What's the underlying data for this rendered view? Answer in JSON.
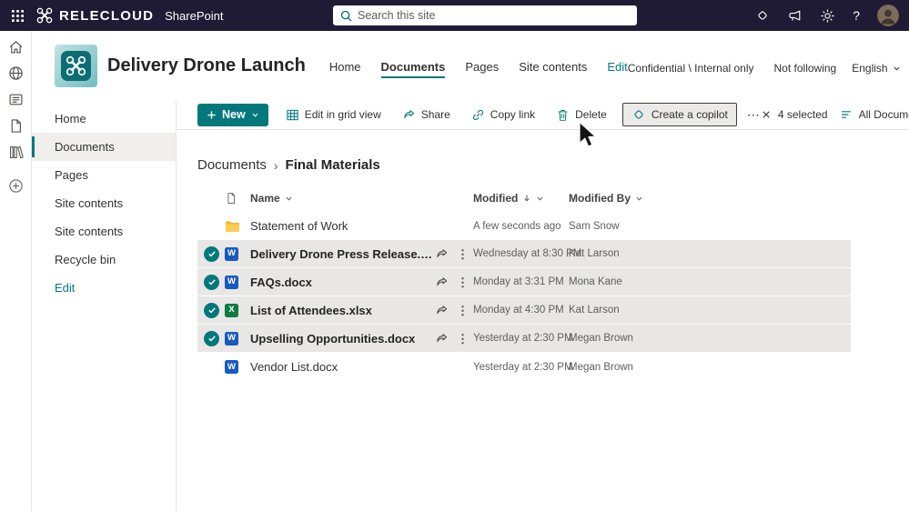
{
  "colors": {
    "topbar_bg": "#1f1b35",
    "accent_teal": "#03787c",
    "selected_row_bg": "#e8e7e6",
    "word_blue": "#185abd",
    "excel_green": "#107c41",
    "folder_yellow": "#fccb53"
  },
  "topbar": {
    "brand": "RELECLOUD",
    "product": "SharePoint",
    "search": {
      "placeholder": "Search this site"
    },
    "icons": [
      "copilot-icon",
      "megaphone-icon",
      "gear-icon"
    ],
    "help_label": "?"
  },
  "left_rail": {
    "icons": [
      "home-icon",
      "globe-icon",
      "news-icon",
      "document-icon",
      "library-icon",
      "add-circle-icon"
    ]
  },
  "site_header": {
    "title": "Delivery Drone Launch",
    "nav": [
      {
        "label": "Home",
        "active": false,
        "accent": false
      },
      {
        "label": "Documents",
        "active": true,
        "accent": false
      },
      {
        "label": "Pages",
        "active": false,
        "accent": false
      },
      {
        "label": "Site contents",
        "active": false,
        "accent": false
      },
      {
        "label": "Edit",
        "active": false,
        "accent": true
      }
    ],
    "classification": "Confidential \\ Internal only",
    "follow_label": "Not following",
    "language": "English"
  },
  "sidebar": {
    "items": [
      {
        "label": "Home",
        "active": false,
        "accent": false
      },
      {
        "label": "Documents",
        "active": true,
        "accent": false
      },
      {
        "label": "Pages",
        "active": false,
        "accent": false
      },
      {
        "label": "Site contents",
        "active": false,
        "accent": false
      },
      {
        "label": "Site contents",
        "active": false,
        "accent": false
      },
      {
        "label": "Recycle bin",
        "active": false,
        "accent": false
      },
      {
        "label": "Edit",
        "active": false,
        "accent": true
      }
    ]
  },
  "command_bar": {
    "new_label": "New",
    "actions": [
      {
        "label": "Edit in grid view",
        "icon": "grid-icon",
        "highlight": false
      },
      {
        "label": "Share",
        "icon": "share-icon",
        "highlight": false
      },
      {
        "label": "Copy link",
        "icon": "copy-link-icon",
        "highlight": false
      },
      {
        "label": "Delete",
        "icon": "delete-icon",
        "highlight": false
      },
      {
        "label": "Create a copilot",
        "icon": "copilot-icon",
        "highlight": true
      }
    ],
    "overflow_label": "⋯",
    "selection_count": "4 selected",
    "view_name": "All Documents"
  },
  "breadcrumb": {
    "root": "Documents",
    "separator": "›",
    "current": "Final Materials"
  },
  "table": {
    "columns": [
      {
        "label": "Name",
        "sorted": false
      },
      {
        "label": "Modified",
        "sorted": true
      },
      {
        "label": "Modified By",
        "sorted": false
      }
    ],
    "rows": [
      {
        "name": "Statement of Work",
        "type": "folder",
        "modified": "A few seconds ago",
        "modified_by": "Sam Snow",
        "selected": false
      },
      {
        "name": "Delivery Drone Press Release.docx",
        "type": "word",
        "modified": "Wednesday at 8:30 PM",
        "modified_by": "Kat Larson",
        "selected": true
      },
      {
        "name": "FAQs.docx",
        "type": "word",
        "modified": "Monday at 3:31 PM",
        "modified_by": "Mona Kane",
        "selected": true
      },
      {
        "name": "List of Attendees.xlsx",
        "type": "excel",
        "modified": "Monday at 4:30 PM",
        "modified_by": "Kat Larson",
        "selected": true
      },
      {
        "name": "Upselling Opportunities.docx",
        "type": "word",
        "modified": "Yesterday at 2:30 PM",
        "modified_by": "Megan Brown",
        "selected": true
      },
      {
        "name": "Vendor List.docx",
        "type": "word",
        "modified": "Yesterday at 2:30 PM",
        "modified_by": "Megan Brown",
        "selected": false
      }
    ]
  }
}
